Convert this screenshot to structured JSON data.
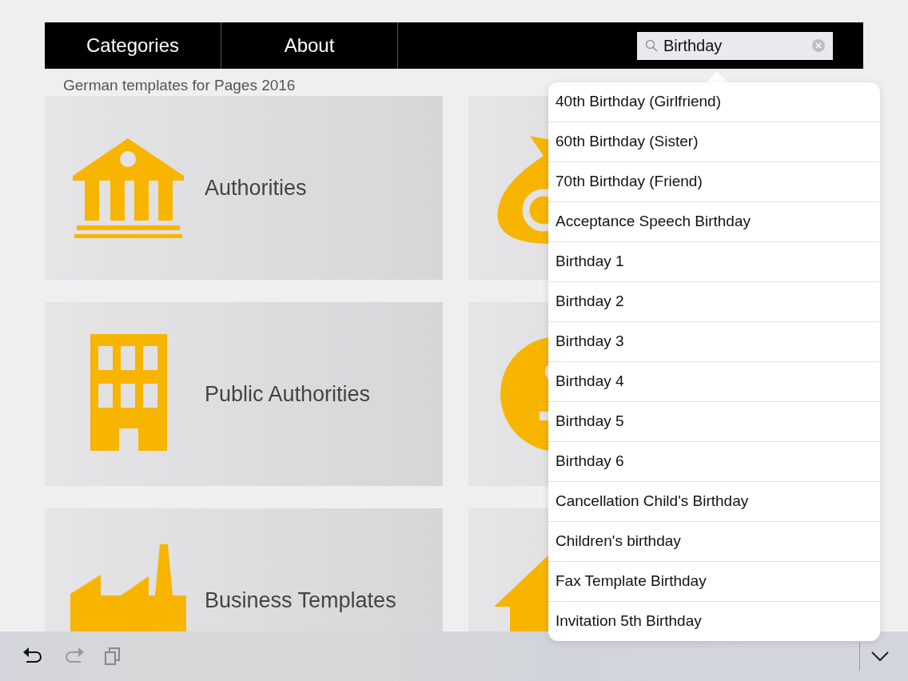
{
  "nav": {
    "tabs": [
      {
        "label": "Categories"
      },
      {
        "label": "About"
      }
    ],
    "search": {
      "value": "Birthday"
    }
  },
  "caption": "German templates for Pages 2016",
  "tiles": [
    "Authorities",
    "Public Authorities",
    "Business Templates"
  ],
  "suggestions": [
    "40th Birthday (Girlfriend)",
    "60th Birthday (Sister)",
    "70th Birthday (Friend)",
    "Acceptance Speech Birthday",
    "Birthday 1",
    "Birthday 2",
    "Birthday 3",
    "Birthday 4",
    "Birthday 5",
    "Birthday 6",
    "Cancellation Child's Birthday",
    "Children's birthday",
    "Fax Template Birthday",
    "Invitation 5th Birthday"
  ],
  "toolbar": {
    "redo_disabled": true
  }
}
